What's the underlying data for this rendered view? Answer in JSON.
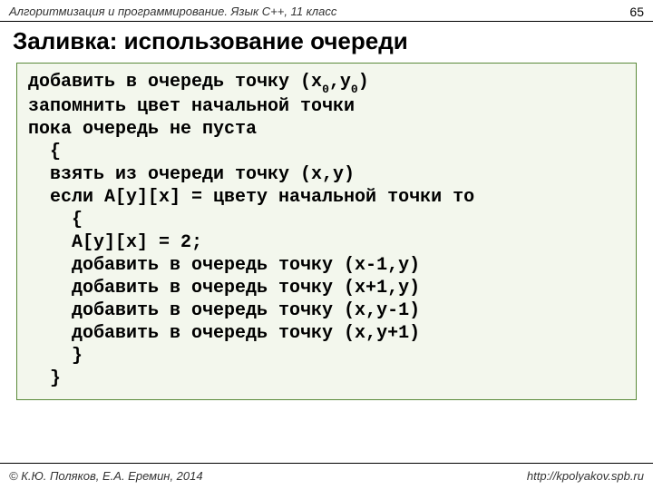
{
  "header": {
    "course": "Алгоритмизация и программирование. Язык C++, 11 класс",
    "page": "65"
  },
  "title": "Заливка: использование очереди",
  "code": {
    "l1a": "добавить в очередь точку (x",
    "l1s1": "0",
    "l1b": ",y",
    "l1s2": "0",
    "l1c": ")",
    "l2": "запомнить цвет начальной точки",
    "l3": "пока очередь не пуста",
    "l4": "  {",
    "l5": "  взять из очереди точку (x,y)",
    "l6": "  если A[y][x] = цвету начальной точки то",
    "l7": "    {",
    "l8": "    A[y][x] = 2;",
    "l9": "    добавить в очередь точку (x-1,y)",
    "l10": "    добавить в очередь точку (x+1,y)",
    "l11": "    добавить в очередь точку (x,y-1)",
    "l12": "    добавить в очередь точку (x,y+1)",
    "l13": "    }",
    "l14": "  }"
  },
  "footer": {
    "left": "© К.Ю. Поляков, Е.А. Еремин, 2014",
    "right": "http://kpolyakov.spb.ru"
  }
}
